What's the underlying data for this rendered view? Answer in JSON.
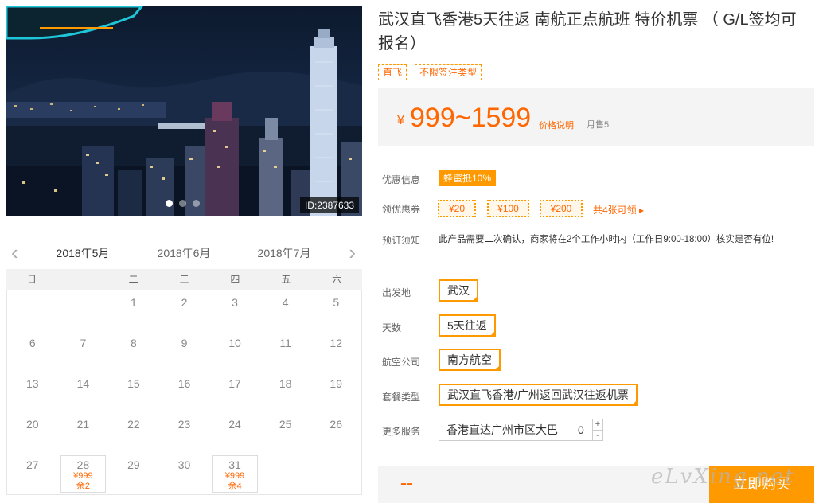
{
  "photo": {
    "id_label": "ID:2387633",
    "slides": 3,
    "active_slide": 1
  },
  "calendar": {
    "prev_icon": "chevron-left-icon",
    "next_icon": "chevron-right-icon",
    "months": [
      "2018年5月",
      "2018年6月",
      "2018年7月"
    ],
    "selected_month": "2018年5月",
    "weekdays": [
      "日",
      "一",
      "二",
      "三",
      "四",
      "五",
      "六"
    ],
    "days": [
      {
        "day": ""
      },
      {
        "day": ""
      },
      {
        "day": "1"
      },
      {
        "day": "2"
      },
      {
        "day": "3"
      },
      {
        "day": "4"
      },
      {
        "day": "5"
      },
      {
        "day": "6"
      },
      {
        "day": "7"
      },
      {
        "day": "8"
      },
      {
        "day": "9"
      },
      {
        "day": "10"
      },
      {
        "day": "11"
      },
      {
        "day": "12"
      },
      {
        "day": "13"
      },
      {
        "day": "14"
      },
      {
        "day": "15"
      },
      {
        "day": "16"
      },
      {
        "day": "17"
      },
      {
        "day": "18"
      },
      {
        "day": "19"
      },
      {
        "day": "20"
      },
      {
        "day": "21"
      },
      {
        "day": "22"
      },
      {
        "day": "23"
      },
      {
        "day": "24"
      },
      {
        "day": "25"
      },
      {
        "day": "26"
      },
      {
        "day": "27"
      },
      {
        "day": "28",
        "price": "¥999",
        "left": "余2"
      },
      {
        "day": "29"
      },
      {
        "day": "30"
      },
      {
        "day": "31",
        "price": "¥999",
        "left": "余4"
      },
      {
        "day": ""
      },
      {
        "day": ""
      }
    ]
  },
  "product": {
    "title": "武汉直飞香港5天往返 南航正点航班 特价机票 （ G/L签均可报名）",
    "tags": [
      "直飞",
      "不限签注类型"
    ],
    "price_symbol": "¥",
    "price_range": "999~1599",
    "price_explain": "价格说明",
    "monthly_sales": "月售5"
  },
  "info": {
    "promo_label": "优惠信息",
    "promo_badge": "蜂蜜抵10%",
    "coupon_label": "领优惠券",
    "coupons": [
      "¥20",
      "¥100",
      "¥200"
    ],
    "coupon_more": "共4张可领 ▸",
    "notice_label": "预订须知",
    "notice_text": "此产品需要二次确认，商家将在2个工作小时内（工作日9:00-18:00）核实是否有位!"
  },
  "options": {
    "departure_label": "出发地",
    "departure_value": "武汉",
    "days_label": "天数",
    "days_value": "5天往返",
    "airline_label": "航空公司",
    "airline_value": "南方航空",
    "package_label": "套餐类型",
    "package_value": "武汉直飞香港/广州返回武汉往返机票",
    "service_label": "更多服务",
    "service_name": "香港直达广州市区大巴",
    "service_qty": "0",
    "plus": "+",
    "minus": "-"
  },
  "buy": {
    "total": "--",
    "button": "立即购买",
    "watermark": "eLvXing.net"
  },
  "colors": {
    "accent": "#ff9900",
    "price": "#ff6600"
  }
}
